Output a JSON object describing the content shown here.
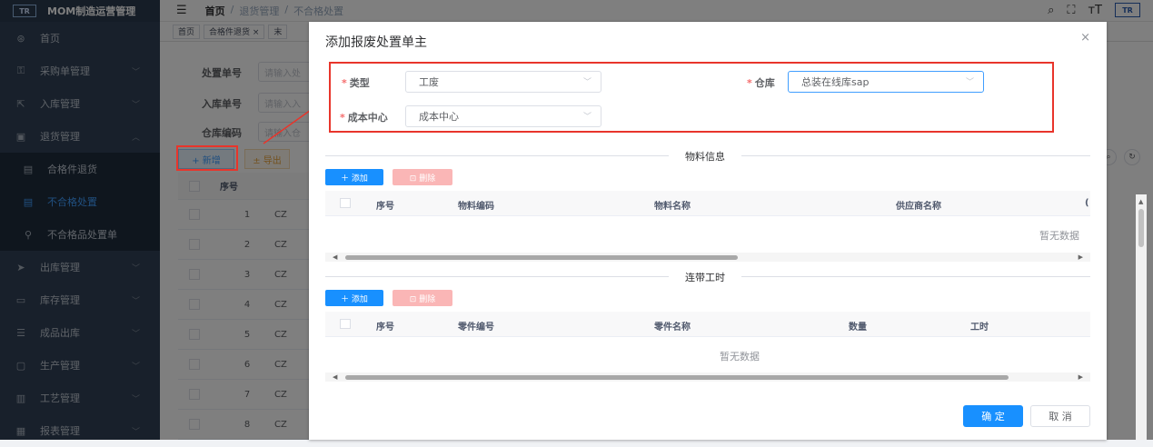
{
  "app": {
    "logo": "TR",
    "title": "MOM制造运营管理"
  },
  "sidebar": {
    "items": [
      {
        "icon": "dashboard-icon",
        "glyph": "⊛",
        "label": "首页",
        "arrow": ""
      },
      {
        "icon": "cart-icon",
        "glyph": "⚿",
        "label": "采购单管理",
        "arrow": "﹀"
      },
      {
        "icon": "inbound-icon",
        "glyph": "⇱",
        "label": "入库管理",
        "arrow": "﹀"
      },
      {
        "icon": "return-icon",
        "glyph": "▣",
        "label": "退货管理",
        "arrow": "︿"
      }
    ],
    "subitems": [
      {
        "icon": "document-icon",
        "glyph": "▤",
        "label": "合格件退货"
      },
      {
        "icon": "document-icon",
        "glyph": "▤",
        "label": "不合格处置"
      },
      {
        "icon": "org-icon",
        "glyph": "⚲",
        "label": "不合格品处置单"
      }
    ],
    "items_after": [
      {
        "icon": "send-icon",
        "glyph": "➤",
        "label": "出库管理",
        "arrow": "﹀"
      },
      {
        "icon": "monitor-icon",
        "glyph": "▭",
        "label": "库存管理",
        "arrow": "﹀"
      },
      {
        "icon": "list-icon",
        "glyph": "☰",
        "label": "成品出库",
        "arrow": "﹀"
      },
      {
        "icon": "screen-icon",
        "glyph": "▢",
        "label": "生产管理",
        "arrow": "﹀"
      },
      {
        "icon": "process-icon",
        "glyph": "▥",
        "label": "工艺管理",
        "arrow": "﹀"
      },
      {
        "icon": "report-icon",
        "glyph": "▦",
        "label": "报表管理",
        "arrow": "﹀"
      }
    ]
  },
  "breadcrumb": {
    "home": "首页",
    "sep": "/",
    "level1": "退货管理",
    "level2": "不合格处置"
  },
  "tags": {
    "home": "首页",
    "t1": "合格件退货 ×",
    "t2": "末"
  },
  "search_form": {
    "f1_label": "处置单号",
    "f1_placeholder": "请输入处",
    "f2_label": "入库单号",
    "f2_placeholder": "请输入入",
    "f3_label": "仓库编码",
    "f3_placeholder": "请输入仓"
  },
  "bg_actions": {
    "add": "+ 新增",
    "export": "± 导出"
  },
  "bg_table": {
    "head": "序号",
    "rows": [
      {
        "idx": "1",
        "code": "CZ"
      },
      {
        "idx": "2",
        "code": "CZ"
      },
      {
        "idx": "3",
        "code": "CZ"
      },
      {
        "idx": "4",
        "code": "CZ"
      },
      {
        "idx": "5",
        "code": "CZ"
      },
      {
        "idx": "6",
        "code": "CZ"
      },
      {
        "idx": "7",
        "code": "CZ"
      },
      {
        "idx": "8",
        "code": "CZ"
      }
    ]
  },
  "dialog": {
    "title": "添加报废处置单主",
    "close": "×",
    "form": {
      "type_label": "类型",
      "type_value": "工废",
      "warehouse_label": "仓库",
      "warehouse_value": "总装在线库sap",
      "cost_center_label": "成本中心",
      "cost_center_value": "成本中心",
      "required_mark": "*"
    },
    "material_section": {
      "title": "物料信息",
      "add_label": "＋ 添加",
      "delete_label": "⊡ 删除",
      "columns": [
        "序号",
        "物料编码",
        "物料名称",
        "供应商名称"
      ],
      "trailing_column": "(",
      "empty_text": "暂无数据"
    },
    "labor_section": {
      "title": "连带工时",
      "add_label": "＋ 添加",
      "delete_label": "⊡ 删除",
      "columns": [
        "序号",
        "零件编号",
        "零件名称",
        "数量",
        "工时"
      ],
      "empty_text": "暂无数据"
    },
    "confirm_label": "确 定",
    "cancel_label": "取 消"
  },
  "colors": {
    "accent": "#1890ff",
    "danger_light": "#fab6b6",
    "annotation_red": "#e8352b",
    "sidebar_bg": "#304156"
  }
}
